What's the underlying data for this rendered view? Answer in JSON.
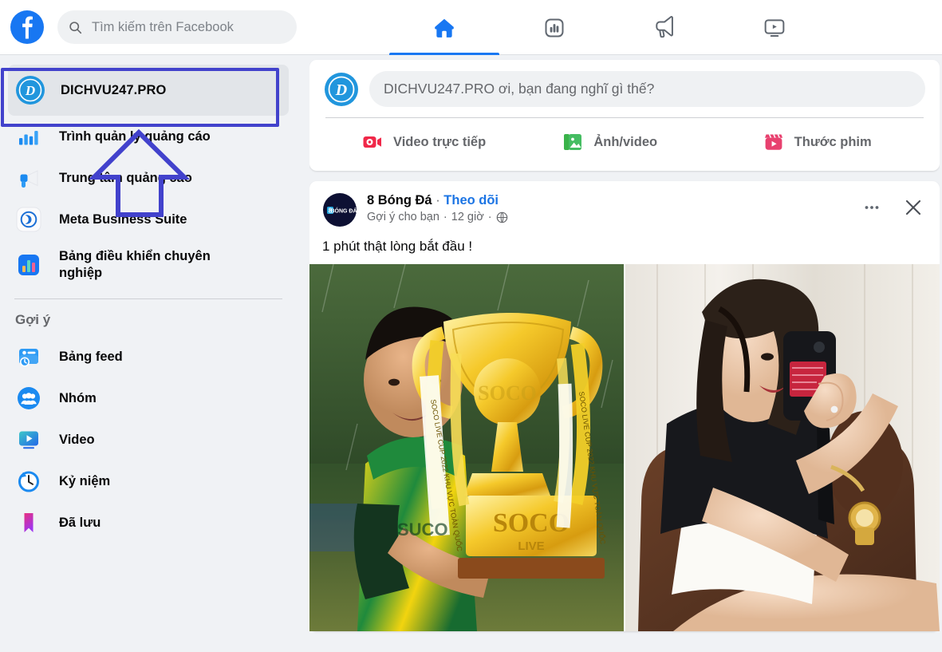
{
  "topbar": {
    "logo_icon": "facebook-logo-icon",
    "search": {
      "icon": "search-icon",
      "placeholder": "Tìm kiếm trên Facebook",
      "value": ""
    },
    "tabs": [
      {
        "name": "home",
        "icon": "home-icon",
        "active": true
      },
      {
        "name": "ads-manager",
        "icon": "bar-chart-square-icon",
        "active": false
      },
      {
        "name": "ad-center",
        "icon": "megaphone-icon",
        "active": false
      },
      {
        "name": "video",
        "icon": "video-monitor-icon",
        "active": false
      }
    ]
  },
  "sidebar": {
    "profile": {
      "label": "DICHVU247.PRO",
      "avatar_icon": "dichvu247-avatar-icon",
      "highlighted": true
    },
    "items": [
      {
        "label": "Trình quản lý quảng cáo",
        "icon": "ads-manager-bars-icon"
      },
      {
        "label": "Trung tâm quảng cáo",
        "icon": "ad-center-megaphone-icon"
      },
      {
        "label": "Meta Business Suite",
        "icon": "meta-business-suite-icon"
      },
      {
        "label": "Bảng điều khiển chuyên nghiệp",
        "icon": "professional-dashboard-icon"
      }
    ],
    "section_title": "Gợi ý",
    "suggestions": [
      {
        "label": "Bảng feed",
        "icon": "feeds-icon"
      },
      {
        "label": "Nhóm",
        "icon": "groups-icon"
      },
      {
        "label": "Video",
        "icon": "video-icon"
      },
      {
        "label": "Kỷ niệm",
        "icon": "memories-clock-icon"
      },
      {
        "label": "Đã lưu",
        "icon": "saved-bookmark-icon"
      }
    ]
  },
  "composer": {
    "avatar_icon": "dichvu247-avatar-icon",
    "placeholder": "DICHVU247.PRO ơi, bạn đang nghĩ gì thế?",
    "actions": [
      {
        "label": "Video trực tiếp",
        "icon": "live-video-icon",
        "color": "#f02849"
      },
      {
        "label": "Ảnh/video",
        "icon": "photo-video-icon",
        "color": "#45bd62"
      },
      {
        "label": "Thước phim",
        "icon": "reels-icon",
        "color": "#e8416f"
      }
    ]
  },
  "post": {
    "author": "8 Bóng Đá",
    "separator": "·",
    "follow_label": "Theo dõi",
    "subtitle_source": "Gợi ý cho bạn",
    "subtitle_time": "12 giờ",
    "audience_icon": "globe-icon",
    "text": "1 phút thật lòng bắt đầu !",
    "menu_icon": "more-options-icon",
    "close_icon": "close-icon",
    "avatar_icon": "8-bong-da-avatar-icon",
    "avatar_text": "8 BÓNG ĐÁ",
    "images": [
      {
        "alt": "Cầu thủ bóng đá áo vàng xanh cầm cúp vàng SOCO LIVE",
        "caption_on_trophy": "SOCO LIVE"
      },
      {
        "alt": "Cô gái áo đen quần short trắng chụp ảnh selfie qua gương"
      }
    ]
  },
  "annotation": {
    "highlight_color": "#4242cc",
    "arrow_icon": "up-arrow-annotation",
    "box_target": "sidebar-profile-item"
  },
  "colors": {
    "brand_blue": "#1877f2",
    "link_blue": "#1b74e4",
    "page_bg": "#f0f2f5",
    "card_bg": "#ffffff",
    "text_primary": "#080809",
    "text_secondary": "#65676b"
  }
}
